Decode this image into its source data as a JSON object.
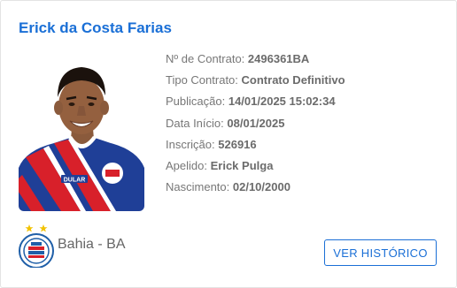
{
  "player": {
    "name": "Erick da Costa Farias",
    "photo_alt": "player-photo"
  },
  "details": [
    {
      "label": "Nº de Contrato:",
      "value": "2496361BA"
    },
    {
      "label": "Tipo Contrato:",
      "value": "Contrato Definitivo"
    },
    {
      "label": "Publicação:",
      "value": "14/01/2025 15:02:34"
    },
    {
      "label": "Data Início:",
      "value": "08/01/2025"
    },
    {
      "label": "Inscrição:",
      "value": "526916"
    },
    {
      "label": "Apelido:",
      "value": "Erick Pulga"
    },
    {
      "label": "Nascimento:",
      "value": "02/10/2000"
    }
  ],
  "club": {
    "name": "Bahia - BA",
    "crest_icon": "bahia-crest-icon"
  },
  "actions": {
    "history_label": "VER HISTÓRICO"
  },
  "colors": {
    "accent": "#1a6fd6",
    "jersey_blue": "#1f3f97",
    "jersey_red": "#d8202a"
  }
}
